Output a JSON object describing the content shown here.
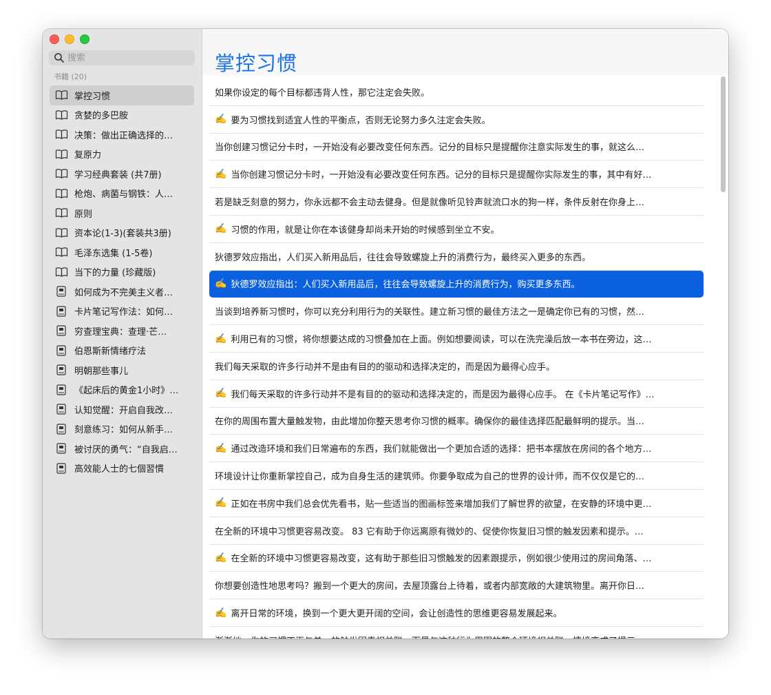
{
  "search": {
    "placeholder": "搜索"
  },
  "sidebar": {
    "section_label": "书籍 (20)",
    "items": [
      {
        "label": "掌控习惯",
        "icon": "book-open-icon"
      },
      {
        "label": "贪婪的多巴胺",
        "icon": "book-open-icon"
      },
      {
        "label": "决策：做出正确选择的…",
        "icon": "book-open-icon"
      },
      {
        "label": "复原力",
        "icon": "book-open-icon"
      },
      {
        "label": "学习经典套装 (共7册)",
        "icon": "book-open-icon"
      },
      {
        "label": "枪炮、病菌与钢铁：人…",
        "icon": "book-open-icon"
      },
      {
        "label": "原则",
        "icon": "book-open-icon"
      },
      {
        "label": "资本论(1-3)(套装共3册)",
        "icon": "book-open-icon"
      },
      {
        "label": "毛泽东选集 (1-5卷)",
        "icon": "book-open-icon"
      },
      {
        "label": "当下的力量 (珍藏版)",
        "icon": "book-open-icon"
      },
      {
        "label": "如何成为不完美主义者…",
        "icon": "book-closed-icon"
      },
      {
        "label": "卡片笔记写作法：如何…",
        "icon": "book-closed-icon"
      },
      {
        "label": "穷查理宝典：查理·芒…",
        "icon": "book-closed-icon"
      },
      {
        "label": "伯恩斯新情绪疗法",
        "icon": "book-closed-icon"
      },
      {
        "label": "明朝那些事儿",
        "icon": "book-closed-icon"
      },
      {
        "label": "《起床后的黄金1小时》…",
        "icon": "book-closed-icon"
      },
      {
        "label": "认知觉醒：开启自我改…",
        "icon": "book-closed-icon"
      },
      {
        "label": "刻意练习：如何从新手…",
        "icon": "book-closed-icon"
      },
      {
        "label": "被讨厌的勇气：“自我启…",
        "icon": "book-closed-icon"
      },
      {
        "label": "高效能人士的七個習慣",
        "icon": "book-closed-icon"
      }
    ]
  },
  "main": {
    "title": "掌控习惯",
    "hand_glyph": "✍️",
    "notes": [
      {
        "text": "如果你设定的每个目标都违背人性，那它注定会失败。",
        "note": false
      },
      {
        "text": "要为习惯找到适宜人性的平衡点，否则无论努力多久注定会失败。",
        "note": true
      },
      {
        "text": "当你创建习惯记分卡时，一开始没有必要改变任何东西。记分的目标只是提醒你注意实际发生的事，就这么…",
        "note": false
      },
      {
        "text": "当你创建习惯记分卡时，一开始没有必要改变任何东西。记分的目标只是提醒你实际发生的事，其中有好…",
        "note": true
      },
      {
        "text": "若是缺乏刻意的努力，你永远都不会主动去健身。但是就像听见铃声就流口水的狗一样，条件反射在你身上…",
        "note": false
      },
      {
        "text": "习惯的作用，就是让你在本该健身却尚未开始的时候感到坐立不安。",
        "note": true
      },
      {
        "text": "狄德罗效应指出，人们买入新用品后，往往会导致螺旋上升的消费行为，最终买入更多的东西。",
        "note": false
      },
      {
        "text": "狄德罗效应指出：人们买入新用品后，往往会导致螺旋上升的消费行为，购买更多东西。",
        "note": true,
        "selected": true
      },
      {
        "text": "当谈到培养新习惯时，你可以充分利用行为的关联性。建立新习惯的最佳方法之一是确定你已有的习惯，然…",
        "note": false
      },
      {
        "text": "利用已有的习惯，将你想要达成的习惯叠加在上面。例如想要阅读，可以在洗完澡后放一本书在旁边，这…",
        "note": true
      },
      {
        "text": "我们每天采取的许多行动并不是由有目的的驱动和选择决定的，而是因为最得心应手。",
        "note": false
      },
      {
        "text": "我们每天采取的许多行动并不是有目的的驱动和选择决定的，而是因为最得心应手。 在《卡片笔记写作》…",
        "note": true
      },
      {
        "text": "在你的周围布置大量触发物，由此增加你整天思考你习惯的概率。确保你的最佳选择匹配最鲜明的提示。当…",
        "note": false
      },
      {
        "text": "通过改造环境和我们日常遍布的东西，我们就能做出一个更加合适的选择：把书本摆放在房间的各个地方…",
        "note": true
      },
      {
        "text": "环境设计让你重新掌控自己，成为自身生活的建筑师。你要争取成为自己的世界的设计师，而不仅仅是它的…",
        "note": false
      },
      {
        "text": "正如在书房中我们总会优先看书，贴一些适当的图画标签来增加我们了解世界的欲望，在安静的环境中更…",
        "note": true
      },
      {
        "text": "在全新的环境中习惯更容易改变。 83   它有助于你远离原有微妙的、促使你恢复旧习惯的触发因素和提示。…",
        "note": false
      },
      {
        "text": "在全新的环境中习惯更容易改变，这有助于那些旧习惯触发的因素跟提示，例如很少使用过的房间角落、…",
        "note": true
      },
      {
        "text": "你想要创造性地思考吗？搬到一个更大的房间，去屋顶露台上待着，或者内部宽敞的大建筑物里。离开你日…",
        "note": false
      },
      {
        "text": "离开日常的环境，换到一个更大更开阔的空间，会让创造性的思维更容易发展起来。",
        "note": true
      },
      {
        "text": "渐渐地，你的习惯不再与单一的触发因素相关联，而是与这种行为周围的整个环境相关联。情境变成了提示…",
        "note": false
      }
    ]
  }
}
